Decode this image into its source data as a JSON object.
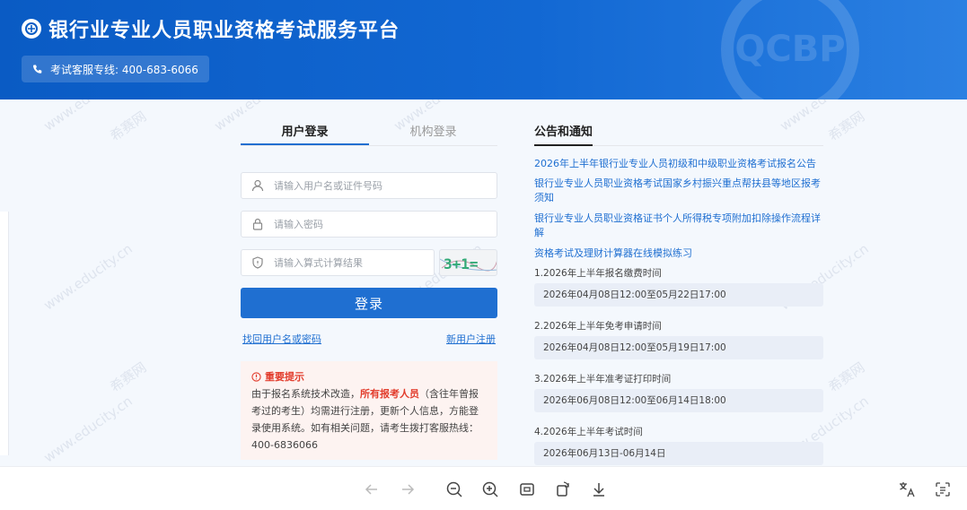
{
  "header": {
    "title": "银行业专业人员职业资格考试服务平台",
    "hotline": "考试客服专线: 400-683-6066",
    "watermark_logo_text": "QCBP"
  },
  "login": {
    "tabs": [
      "用户登录",
      "机构登录"
    ],
    "username_placeholder": "请输入用户名或证件号码",
    "password_placeholder": "请输入密码",
    "captcha_placeholder": "请输入算式计算结果",
    "captcha_text": "3+1=",
    "login_button": "登录",
    "forgot_link": "找回用户名或密码",
    "register_link": "新用户注册"
  },
  "notice": {
    "heading": "重要提示",
    "text_before": "由于报名系统技术改造，",
    "highlight": "所有报考人员",
    "text_after": "（含往年曾报考过的考生）均需进行注册，更新个人信息，方能登录使用系统。如有相关问题，请考生拨打客服热线：400-6836066"
  },
  "announcements": {
    "title": "公告和通知",
    "news": [
      "2026年上半年银行业专业人员初级和中级职业资格考试报名公告",
      "银行业专业人员职业资格考试国家乡村振兴重点帮扶县等地区报考须知",
      "银行业专业人员职业资格证书个人所得税专项附加扣除操作流程详解",
      "资格考试及理财计算器在线模拟练习"
    ],
    "schedule": [
      {
        "label": "1.2026年上半年报名缴费时间",
        "value": "2026年04月08日12:00至05月22日17:00"
      },
      {
        "label": "2.2026年上半年免考申请时间",
        "value": "2026年04月08日12:00至05月19日17:00"
      },
      {
        "label": "3.2026年上半年准考证打印时间",
        "value": "2026年06月08日12:00至06月14日18:00"
      },
      {
        "label": "4.2026年上半年考试时间",
        "value": "2026年06月13日-06月14日"
      }
    ]
  },
  "watermarks": {
    "site": "www.educity.cn",
    "brand": "希赛网",
    "brand_short": "希赛"
  },
  "colors": {
    "primary": "#1f6fd1",
    "header": "#0a5bc4",
    "alert": "#e23c2c"
  },
  "toolbar_icons": [
    "arrow-left-icon",
    "arrow-right-icon",
    "zoom-out-icon",
    "zoom-in-icon",
    "fit-screen-icon",
    "rotate-icon",
    "download-icon",
    "translate-icon",
    "text-extract-icon"
  ]
}
